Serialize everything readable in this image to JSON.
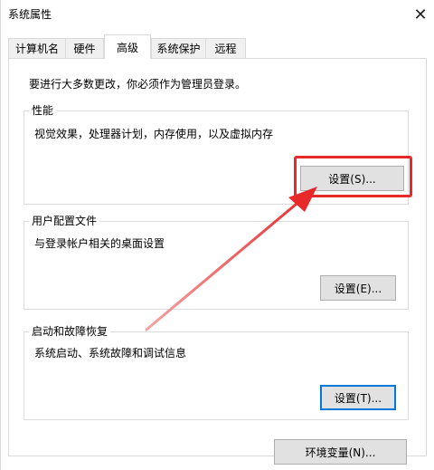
{
  "window": {
    "title": "系统属性",
    "close_glyph": "✕"
  },
  "tabs": [
    {
      "label": "计算机名",
      "active": false
    },
    {
      "label": "硬件",
      "active": false
    },
    {
      "label": "高级",
      "active": true
    },
    {
      "label": "系统保护",
      "active": false
    },
    {
      "label": "远程",
      "active": false
    }
  ],
  "advanced": {
    "admin_note": "要进行大多数更改，你必须作为管理员登录。",
    "performance": {
      "title": "性能",
      "description": "视觉效果，处理器计划，内存使用，以及虚拟内存",
      "button": "设置(S)..."
    },
    "user_profiles": {
      "title": "用户配置文件",
      "description": "与登录帐户相关的桌面设置",
      "button": "设置(E)..."
    },
    "startup_recovery": {
      "title": "启动和故障恢复",
      "description": "系统启动、系统故障和调试信息",
      "button": "设置(T)..."
    },
    "env_button": "环境变量(N)..."
  },
  "annotation": {
    "color": "#e8292a"
  },
  "icons": {
    "close": "close-icon"
  }
}
